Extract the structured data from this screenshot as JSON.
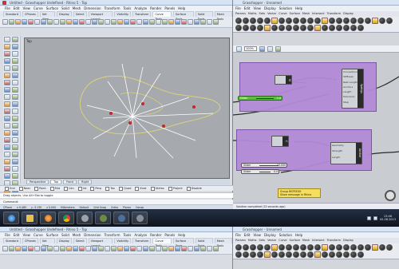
{
  "rhino": {
    "title": "Untitled - Grasshopper Undefined - Rhino 5 - Top",
    "menu": [
      "File",
      "Edit",
      "View",
      "Curve",
      "Surface",
      "Solid",
      "Mesh",
      "Dimension",
      "Transform",
      "Tools",
      "Analyze",
      "Render",
      "Panels",
      "Help"
    ],
    "tabs": [
      "Standard",
      "CPlanes",
      "Set View",
      "Display",
      "Select",
      "Viewport Layout",
      "Visibility",
      "Transform",
      "Curve Tools",
      "Surface Tools",
      "Solid Tools",
      "Mesh Tools"
    ],
    "active_tab_index": 8,
    "viewport_label": "Top",
    "viewport_tabs": [
      "Perspective",
      "Top",
      "Front",
      "Right"
    ],
    "active_viewport_tab_index": 1,
    "osnaps": [
      "End",
      "Near",
      "Point",
      "Mid",
      "Cen",
      "Int",
      "Perp",
      "Tan",
      "Quad",
      "Knot",
      "Vertex",
      "Project",
      "Disable"
    ],
    "command_history": "Drag objects, Use Alt+Tab to toggle",
    "command_prompt": "Command:",
    "status": [
      "CPlane",
      "x 9.485",
      "y -3.130",
      "z 0.000",
      "Millimeters",
      "Default",
      "Grid Snap",
      "Ortho",
      "Planar",
      "Osnap"
    ],
    "colors": {
      "curve": "#d8d27a",
      "lines": "#ffffff",
      "points": "#c0282b",
      "viewport_bg": "#a6a9ad"
    }
  },
  "grasshopper": {
    "title": "Grasshopper - Unnamed",
    "menu": [
      "File",
      "Edit",
      "View",
      "Display",
      "Solution",
      "Help"
    ],
    "tabs": [
      "Params",
      "Maths",
      "Sets",
      "Vector",
      "Curve",
      "Surface",
      "Mesh",
      "Intersect",
      "Transform",
      "Display"
    ],
    "zoom_label": "100%",
    "groups": [
      {
        "name": "Spring Solver",
        "inputs": [
          "Connections",
          "Stiffness",
          "Rest Length",
          "Anchors",
          "Length",
          "Tolerance",
          "Step"
        ],
        "label": "Springs"
      },
      {
        "name": "Anchor Solver",
        "inputs": [
          "Geometry",
          "Strength",
          "Length"
        ],
        "label": "Anchor"
      }
    ],
    "sliders": [
      {
        "label": "Slider",
        "value": "1.0",
        "green": true
      },
      {
        "label": "Slider",
        "value": "10.000",
        "green": false
      },
      {
        "label": "Slider",
        "value": "0.0",
        "green": false
      }
    ],
    "note": {
      "title": "Group REFRESH",
      "text": "Show message in Rhino"
    },
    "status": "Solution completed (15 seconds ago)",
    "colors": {
      "group": "#b28ad6",
      "canvas": "#c9ccd1",
      "slider_active": "#58c23a",
      "note": "#f5de5e"
    }
  },
  "taskbar": {
    "apps": [
      "start-orb",
      "explorer",
      "media-player",
      "chrome",
      "rhino",
      "grasshopper",
      "app-7",
      "app-8"
    ],
    "time": "13:46",
    "date": "05.08.2013"
  },
  "duplicate_window": {
    "rhino_title": "Untitled - Grasshopper Undefined - Rhino 5 - Top",
    "gh_title": "Grasshopper - Unnamed"
  }
}
